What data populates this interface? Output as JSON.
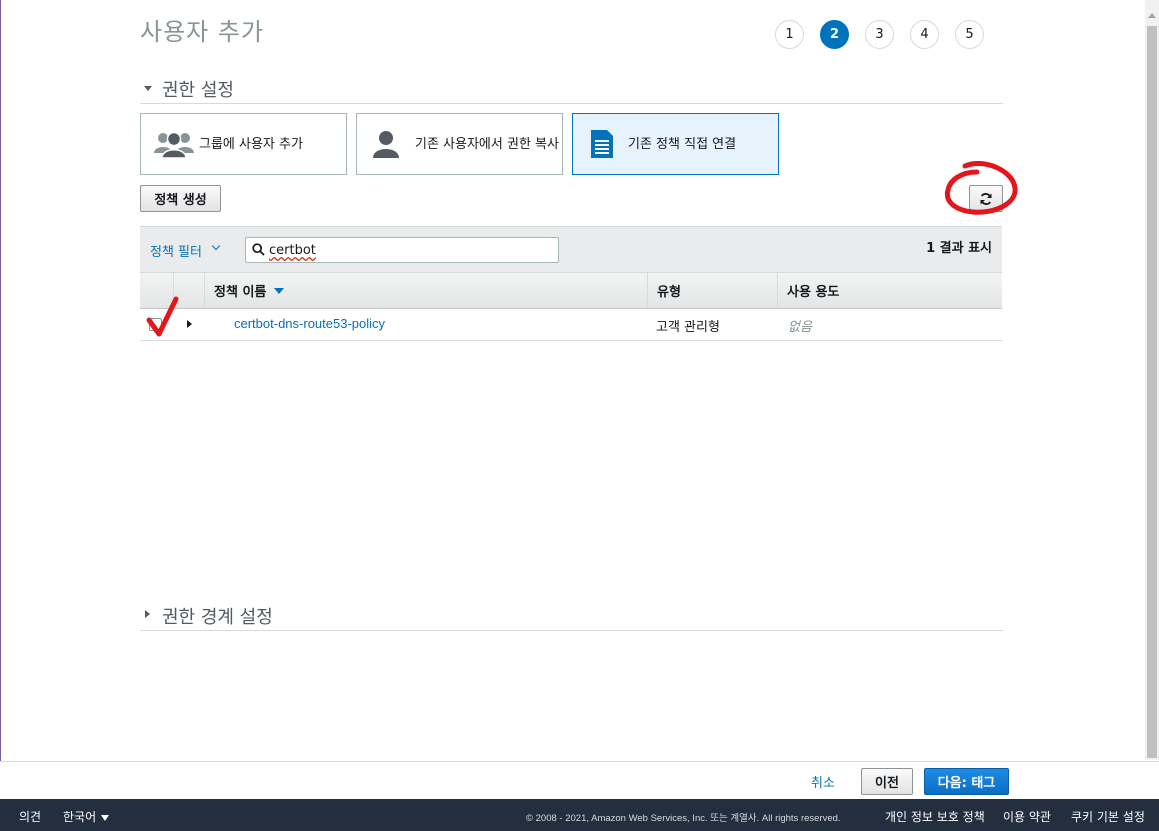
{
  "page": {
    "title": "사용자 추가",
    "steps": [
      "1",
      "2",
      "3",
      "4",
      "5"
    ],
    "active_step": "2"
  },
  "permissions": {
    "section_title": "권한 설정",
    "options": [
      {
        "label": "그룹에 사용자 추가",
        "icon": "users-group-icon",
        "selected": false
      },
      {
        "label": "기존 사용자에서 권한 복사",
        "icon": "user-icon",
        "selected": false
      },
      {
        "label": "기존 정책 직접 연결",
        "icon": "document-icon",
        "selected": true
      }
    ],
    "create_policy_button": "정책 생성",
    "filter_label": "정책 필터",
    "search_value": "certbot",
    "results_text": "1 결과 표시",
    "columns": {
      "name": "정책 이름",
      "type": "유형",
      "usage": "사용 용도"
    },
    "rows": [
      {
        "name": "certbot-dns-route53-policy",
        "type": "고객 관리형",
        "usage": "없음"
      }
    ]
  },
  "boundary": {
    "section_title": "권한 경계 설정"
  },
  "actions": {
    "cancel": "취소",
    "previous": "이전",
    "next": "다음: 태그"
  },
  "footer": {
    "feedback": "의견",
    "language": "한국어",
    "copyright": "© 2008 - 2021, Amazon Web Services, Inc. 또는 계열사. All rights reserved.",
    "privacy": "개인 정보 보호 정책",
    "terms": "이용 약관",
    "cookies": "쿠키 기본 설정"
  },
  "colors": {
    "accent": "#0073bb",
    "annotation": "#e3161c",
    "footer_bg": "#232f3e"
  }
}
